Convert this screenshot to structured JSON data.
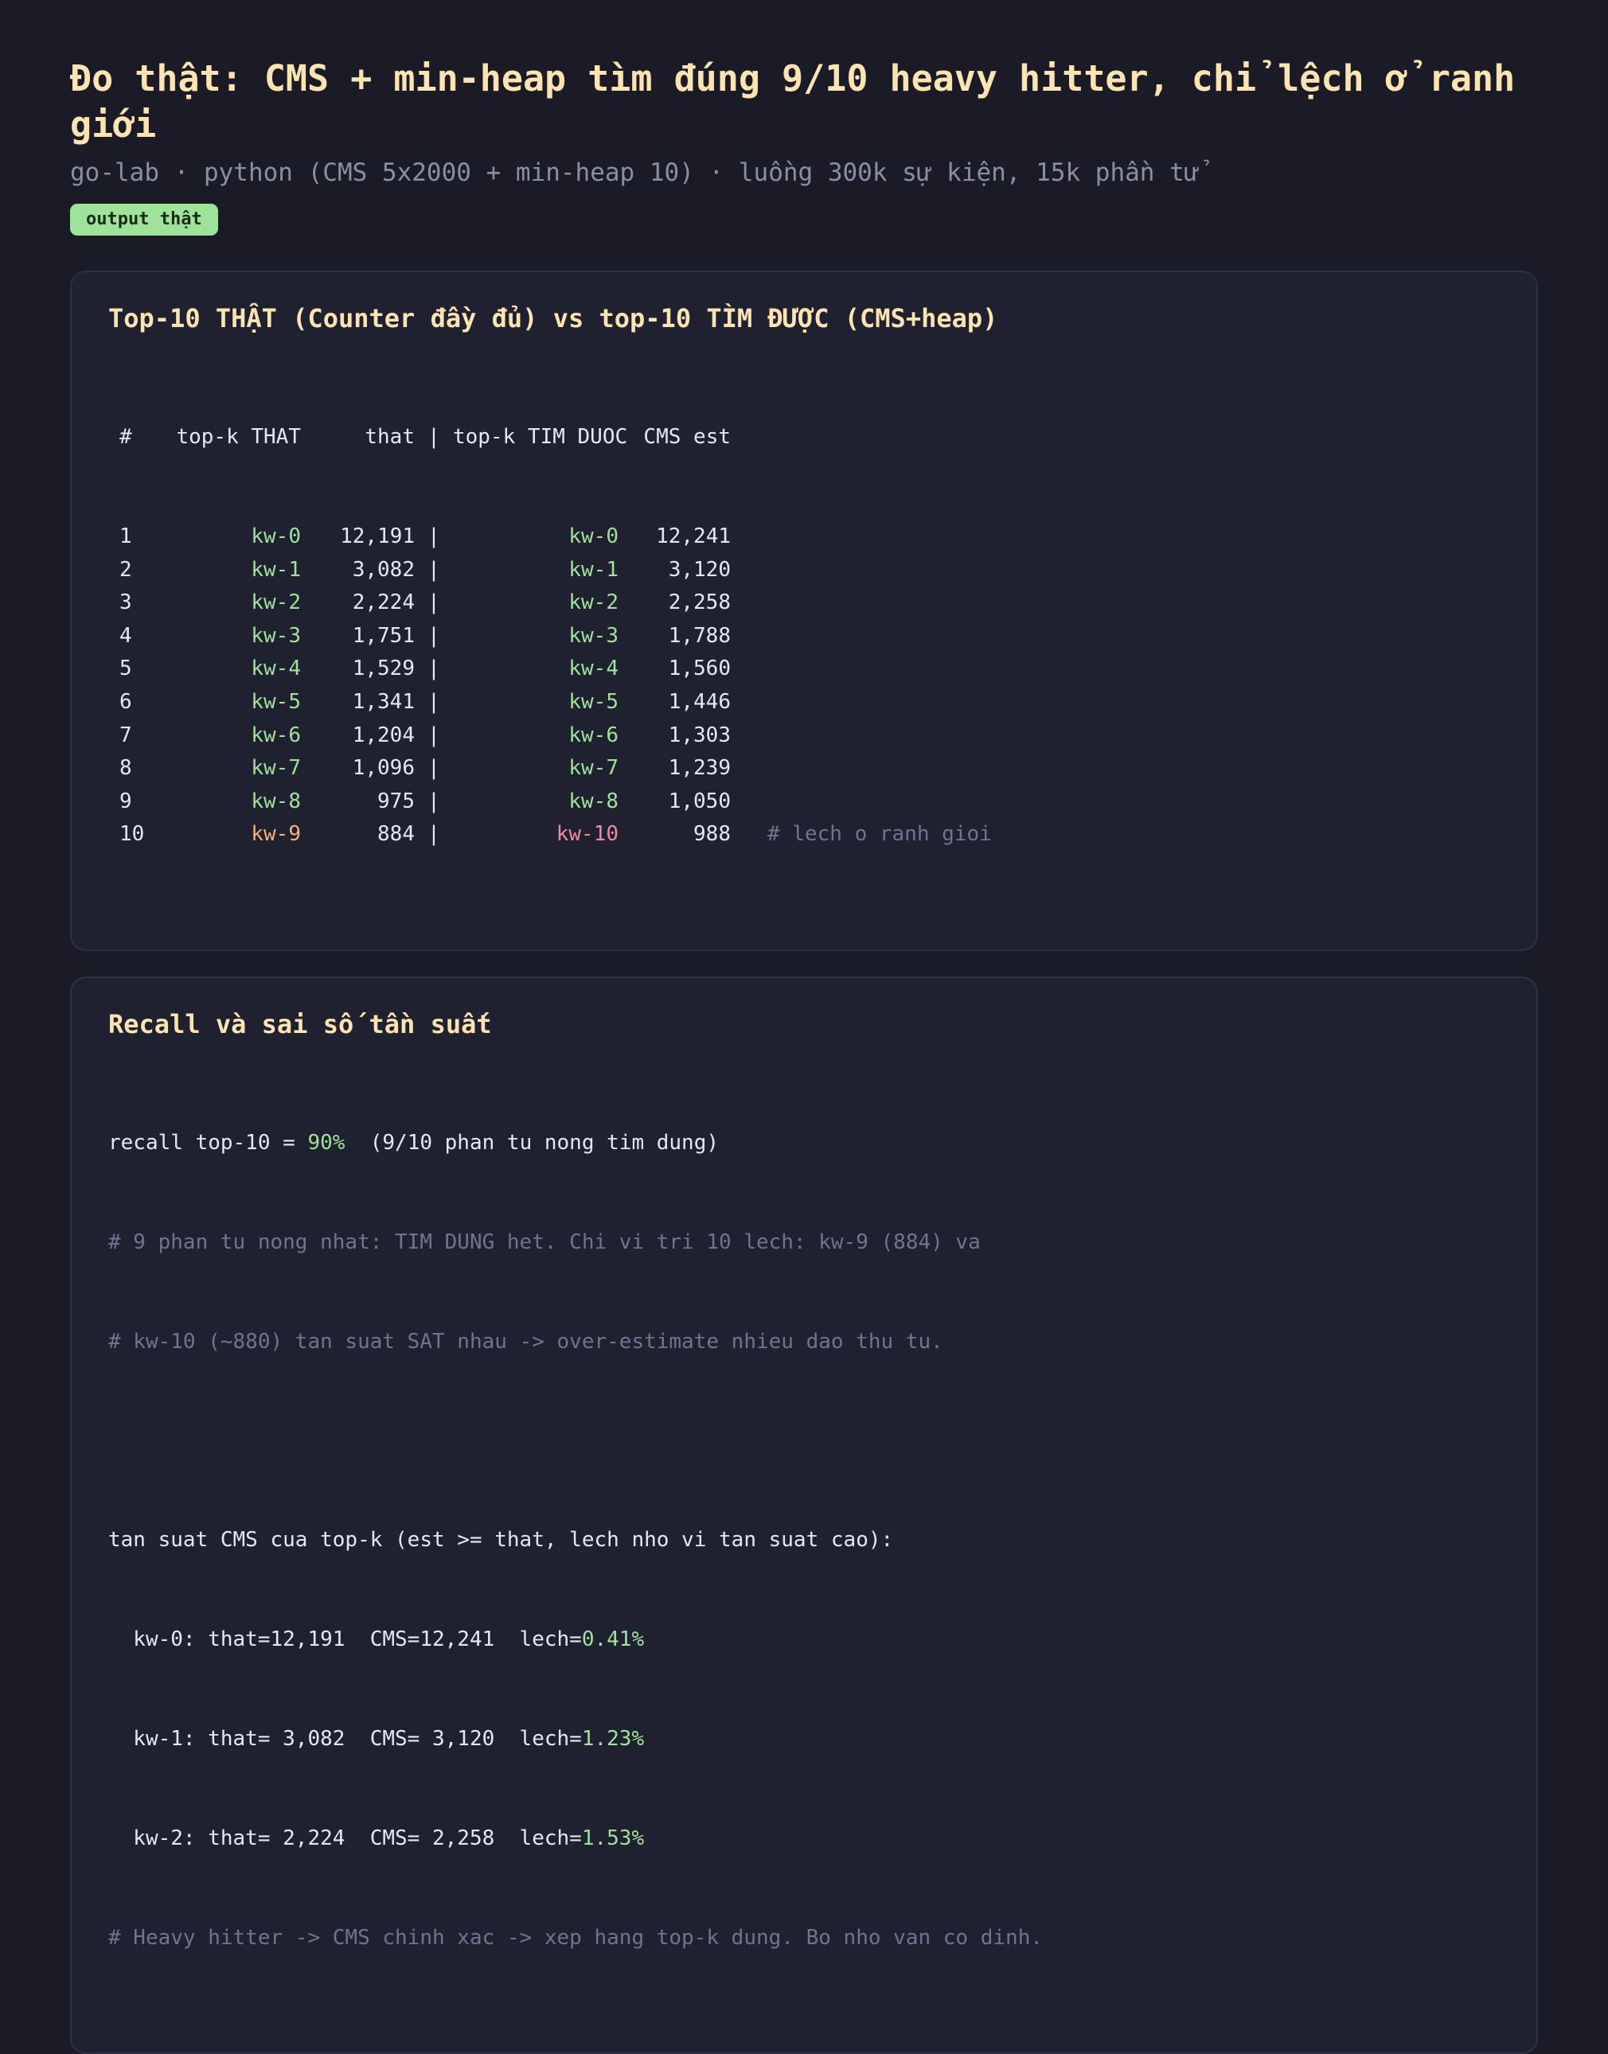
{
  "header": {
    "title": "Đo thật: CMS + min-heap tìm đúng 9/10 heavy hitter, chỉ lệch ở ranh giới",
    "subtitle": "go-lab · python (CMS 5x2000 + min-heap 10) · luồng 300k sự kiện, 15k phần tử",
    "badge": "output thật"
  },
  "topk_card": {
    "title": "Top-10 THẬT (Counter đầy đủ) vs top-10 TÌM ĐƯỢC (CMS+heap)",
    "columns": {
      "num": "#",
      "key_true": "top-k THAT",
      "val_true": "that",
      "sep": "|",
      "key_found": "top-k TIM DUOC",
      "val_est": "CMS est"
    },
    "rows": [
      {
        "num": "1",
        "key_true": "kw-0",
        "val_true": "12,191",
        "sep": "|",
        "key_found": "kw-0",
        "val_est": "12,241",
        "note": ""
      },
      {
        "num": "2",
        "key_true": "kw-1",
        "val_true": "3,082",
        "sep": "|",
        "key_found": "kw-1",
        "val_est": "3,120",
        "note": ""
      },
      {
        "num": "3",
        "key_true": "kw-2",
        "val_true": "2,224",
        "sep": "|",
        "key_found": "kw-2",
        "val_est": "2,258",
        "note": ""
      },
      {
        "num": "4",
        "key_true": "kw-3",
        "val_true": "1,751",
        "sep": "|",
        "key_found": "kw-3",
        "val_est": "1,788",
        "note": ""
      },
      {
        "num": "5",
        "key_true": "kw-4",
        "val_true": "1,529",
        "sep": "|",
        "key_found": "kw-4",
        "val_est": "1,560",
        "note": ""
      },
      {
        "num": "6",
        "key_true": "kw-5",
        "val_true": "1,341",
        "sep": "|",
        "key_found": "kw-5",
        "val_est": "1,446",
        "note": ""
      },
      {
        "num": "7",
        "key_true": "kw-6",
        "val_true": "1,204",
        "sep": "|",
        "key_found": "kw-6",
        "val_est": "1,303",
        "note": ""
      },
      {
        "num": "8",
        "key_true": "kw-7",
        "val_true": "1,096",
        "sep": "|",
        "key_found": "kw-7",
        "val_est": "1,239",
        "note": ""
      },
      {
        "num": "9",
        "key_true": "kw-8",
        "val_true": "975",
        "sep": "|",
        "key_found": "kw-8",
        "val_est": "1,050",
        "note": ""
      },
      {
        "num": "10",
        "key_true": "kw-9",
        "val_true": "884",
        "sep": "|",
        "key_found": "kw-10",
        "val_est": "988",
        "note": "# lech o ranh gioi"
      }
    ]
  },
  "recall_card": {
    "title": "Recall và sai số tần suất",
    "recall_prefix": "recall top-10 = ",
    "recall_value": "90%",
    "recall_suffix": "  (9/10 phan tu nong tim dung)",
    "comment1": "# 9 phan tu nong nhat: TIM DUNG het. Chi vi tri 10 lech: kw-9 (884) va",
    "comment2": "# kw-10 (~880) tan suat SAT nhau -> over-estimate nhieu dao thu tu.",
    "freq_header": "tan suat CMS cua top-k (est >= that, lech nho vi tan suat cao):",
    "freq_rows": [
      {
        "prefix": "  kw-0: that=12,191  CMS=12,241  lech=",
        "pct": "0.41%"
      },
      {
        "prefix": "  kw-1: that= 3,082  CMS= 3,120  lech=",
        "pct": "1.23%"
      },
      {
        "prefix": "  kw-2: that= 2,224  CMS= 2,258  lech=",
        "pct": "1.53%"
      }
    ],
    "footer_comment": "# Heavy hitter -> CMS chinh xac -> xep hang top-k dung. Bo nho van co dinh."
  },
  "colors": {
    "background": "#1a1b26",
    "title": "#fce4b0",
    "match": "#9fe39a",
    "true_boundary": "#f4b27a",
    "found_boundary": "#f08ca0",
    "comment": "#6f7490"
  }
}
